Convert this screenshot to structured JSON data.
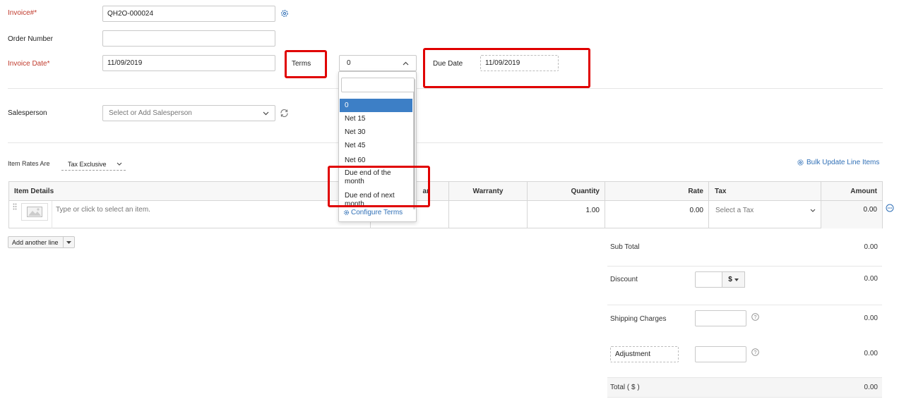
{
  "form": {
    "invoice_label": "Invoice#",
    "invoice_value": "QH2O-000024",
    "order_label": "Order Number",
    "order_value": "",
    "date_label": "Invoice Date",
    "date_value": "11/09/2019",
    "terms_label": "Terms",
    "terms_value": "0",
    "due_label": "Due Date",
    "due_value": "11/09/2019",
    "salesperson_label": "Salesperson",
    "salesperson_placeholder": "Select or Add Salesperson",
    "required_mark": "*"
  },
  "terms_dropdown": {
    "search_value": "",
    "options": [
      "0",
      "Net 15",
      "Net 30",
      "Net 45",
      "Net 60",
      "Due end of the month",
      "Due end of next month"
    ],
    "selected": "0",
    "configure_label": "Configure Terms"
  },
  "rates": {
    "label": "Item Rates Are",
    "value": "Tax Exclusive",
    "bulk_update": "Bulk Update Line Items"
  },
  "table": {
    "headers": [
      "Item Details",
      "ar",
      "Warranty",
      "Quantity",
      "Rate",
      "Tax",
      "Amount"
    ],
    "row": {
      "item_placeholder": "Type or click to select an item.",
      "quantity": "1.00",
      "rate": "0.00",
      "tax_placeholder": "Select a Tax",
      "amount": "0.00"
    },
    "add_line": "Add another line"
  },
  "totals": {
    "subtotal_label": "Sub Total",
    "subtotal": "0.00",
    "discount_label": "Discount",
    "discount_unit": "$",
    "discount": "0.00",
    "shipping_label": "Shipping Charges",
    "shipping": "0.00",
    "adjustment_label": "Adjustment",
    "adjustment": "0.00",
    "total_label": "Total ( $ )",
    "total": "0.00"
  },
  "colors": {
    "required": "#c0392b",
    "link": "#2f6fb6",
    "highlight": "#e00000",
    "selected": "#3d7fc6"
  }
}
